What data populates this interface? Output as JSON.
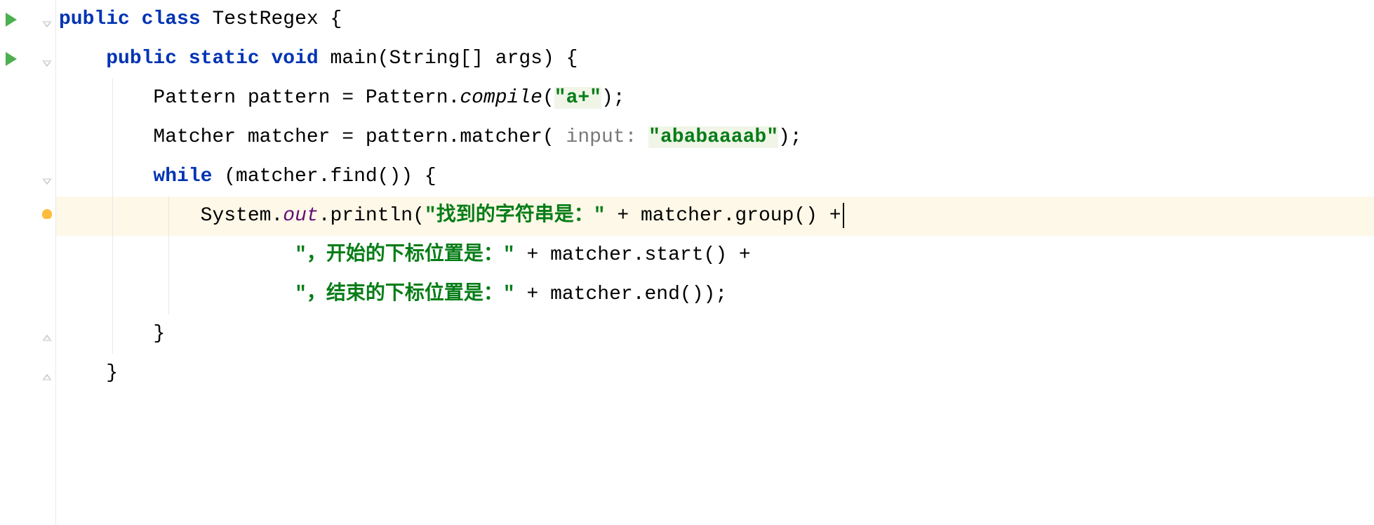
{
  "code": {
    "line1": {
      "kw_public": "public",
      "kw_class": "class",
      "class_name": "TestRegex",
      "brace": "{"
    },
    "line2": {
      "kw_public": "public",
      "kw_static": "static",
      "kw_void": "void",
      "method_name": "main",
      "params": "(String[] args)",
      "brace": "{"
    },
    "line3": {
      "type1": "Pattern",
      "var": "pattern",
      "eq": " = ",
      "type2": "Pattern.",
      "method": "compile",
      "open": "(",
      "str": "\"a+\"",
      "close": ");"
    },
    "line4": {
      "type1": "Matcher",
      "var": "matcher",
      "eq": " = pattern.matcher(",
      "hint": " input: ",
      "str": "\"ababaaaab\"",
      "close": ");"
    },
    "line5": {
      "kw_while": "while",
      "rest": " (matcher.find()) {"
    },
    "line6": {
      "pre": "System.",
      "field": "out",
      "post": ".println(",
      "str": "\"找到的字符串是：\"",
      "rest": " + matcher.group() +"
    },
    "line7": {
      "str": "\"，开始的下标位置是：\"",
      "rest": " + matcher.start() +"
    },
    "line8": {
      "str": "\"，结束的下标位置是：\"",
      "rest": " + matcher.end());"
    },
    "line9": {
      "brace": "}"
    },
    "line10": {
      "brace": "}"
    }
  }
}
